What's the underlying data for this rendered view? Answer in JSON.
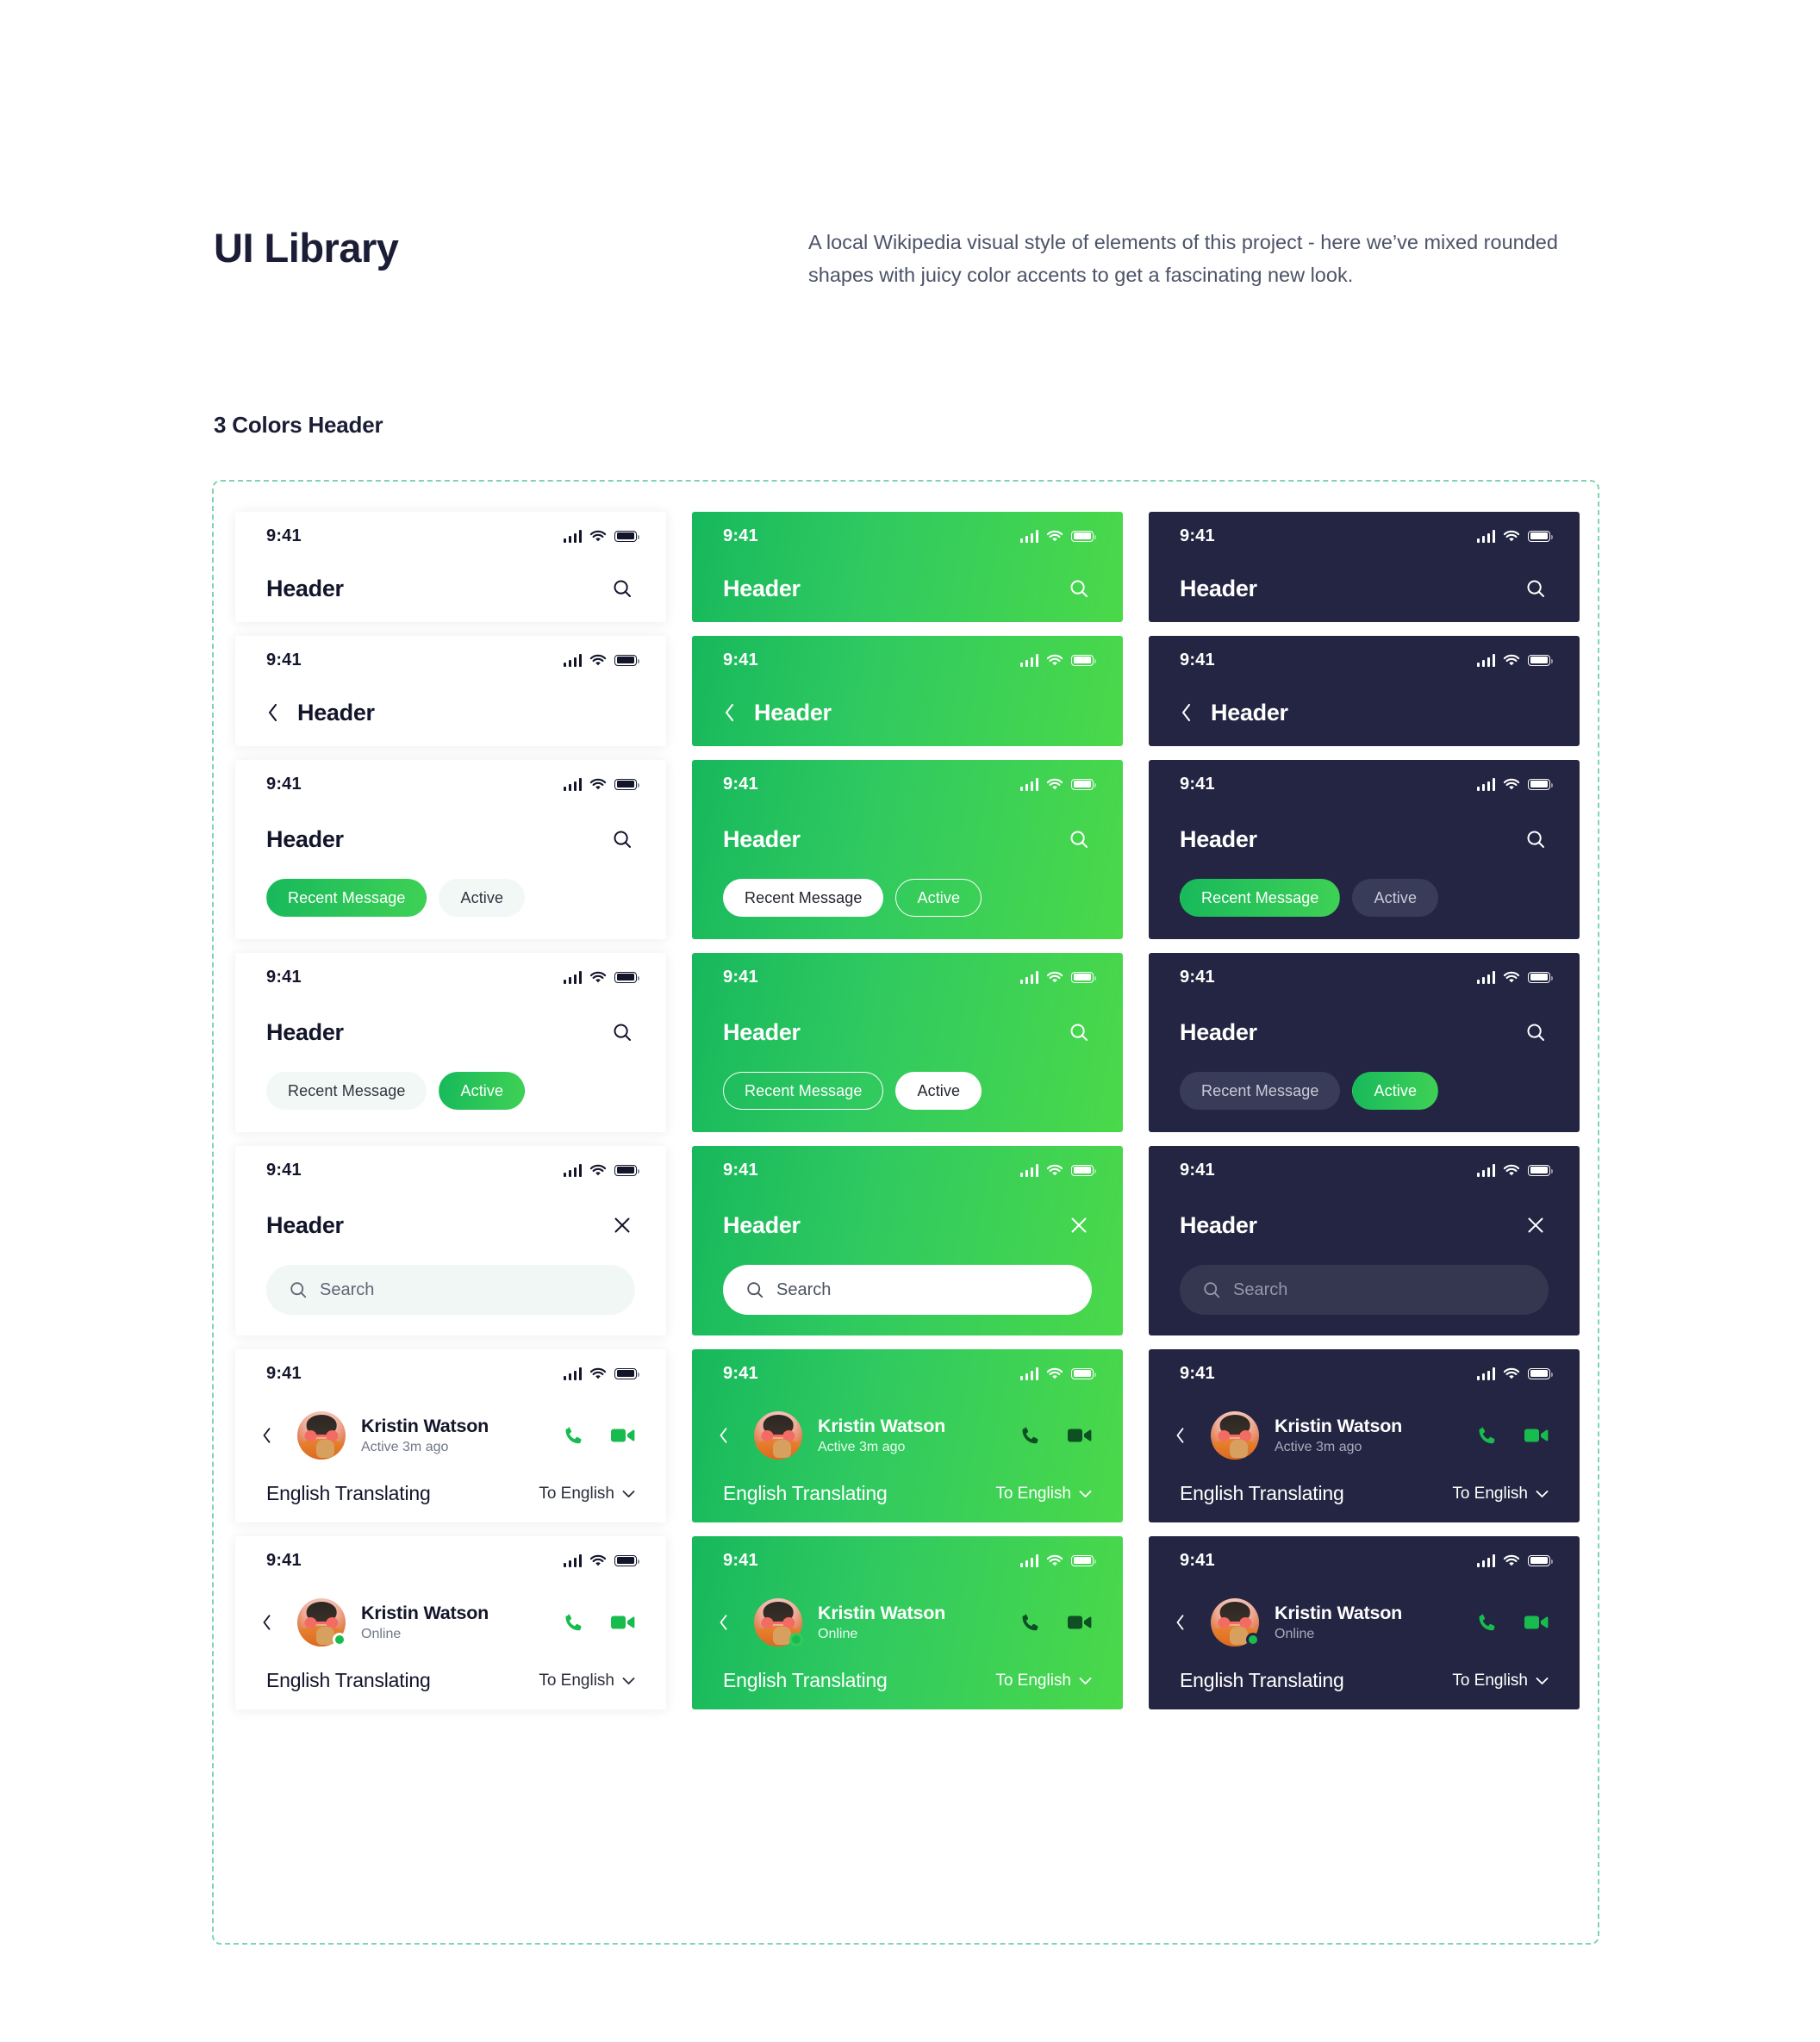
{
  "header": {
    "title": "UI Library",
    "description": "A local Wikipedia visual style of elements of this project - here we’ve mixed rounded shapes with juicy color accents to get a fascinating new look."
  },
  "section": {
    "title": "3 Colors Header"
  },
  "statusbar": {
    "time": "9:41",
    "signal_icon": "signal-bars-icon",
    "wifi_icon": "wifi-icon",
    "battery_icon": "battery-icon"
  },
  "labels": {
    "header": "Header",
    "search_placeholder": "Search",
    "chip_recent": "Recent Message",
    "chip_active": "Active",
    "contact_name": "Kristin Watson",
    "contact_status_recent": "Active 3m ago",
    "contact_status_online": "Online",
    "translating": "English Translating",
    "to_english": "To English"
  },
  "icons": {
    "search": "search-icon",
    "close": "close-icon",
    "back": "chevron-left-icon",
    "chevron_down": "chevron-down-icon",
    "phone": "phone-call-icon",
    "video": "video-camera-icon",
    "presence": "online-status-dot"
  },
  "colors": {
    "dark_navy": "#232542",
    "green_start": "#17B85C",
    "green_end": "#4BD94A",
    "accent_green": "#18BC4E",
    "dashed_border": "#7FD6AE",
    "light_surface": "#FFFFFF",
    "text_dark": "#13152B",
    "text_muted": "#707787"
  },
  "variants": [
    "light",
    "green",
    "dark"
  ],
  "rows": [
    {
      "name": "title-with-search",
      "type": "title",
      "action": "search"
    },
    {
      "name": "back-title",
      "type": "back",
      "action": "none"
    },
    {
      "name": "title-chips-recent",
      "type": "chips",
      "action": "search",
      "selected": "recent"
    },
    {
      "name": "title-chips-active",
      "type": "chips",
      "action": "search",
      "selected": "active"
    },
    {
      "name": "title-with-search-bar",
      "type": "search",
      "action": "close"
    },
    {
      "name": "contact-recent",
      "type": "contact",
      "status": "recent"
    },
    {
      "name": "contact-online",
      "type": "contact",
      "status": "online"
    }
  ]
}
